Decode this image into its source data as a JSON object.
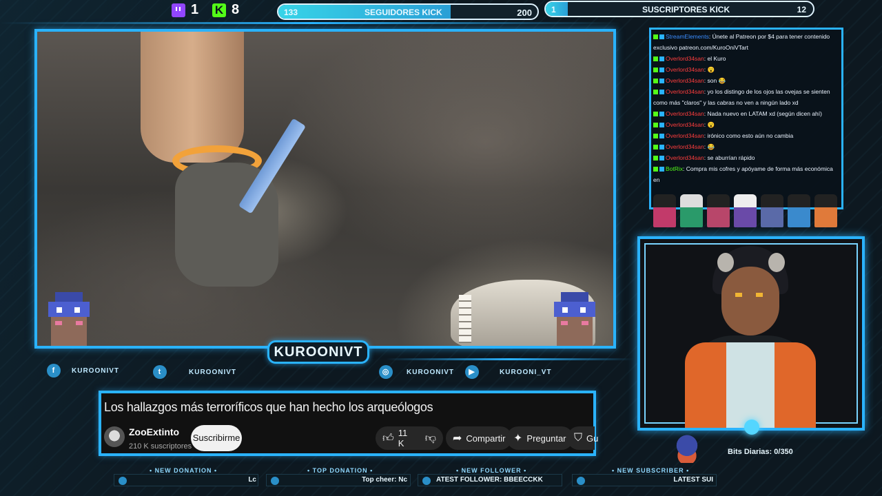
{
  "top_bar": {
    "twitch_count": "1",
    "kick_count": "8",
    "followers_goal": {
      "current": "133",
      "label": "SEGUIDORES KICK",
      "target": "200",
      "progress": 0.665
    },
    "subs_goal": {
      "current": "1",
      "label": "SUSCRIPTORES KICK",
      "target": "12",
      "progress": 0.083
    }
  },
  "streamer_name": "KUROONIVT",
  "socials": [
    {
      "icon": "facebook-icon",
      "glyph": "f",
      "handle": "KUROONIVT"
    },
    {
      "icon": "twitter-icon",
      "glyph": "t",
      "handle": "KUROONIVT"
    },
    {
      "icon": "instagram-icon",
      "glyph": "◎",
      "handle": "KUROONIVT"
    },
    {
      "icon": "youtube-icon",
      "glyph": "▶",
      "handle": "KUROONI_VT"
    }
  ],
  "video": {
    "title": "Los hallazgos más terroríficos que han hecho los arqueólogos",
    "channel": "ZooExtinto",
    "subscribers": "210 K suscriptores",
    "subscribe_label": "Suscribirme",
    "likes": "11 K",
    "share_label": "Compartir",
    "ask_label": "Preguntar",
    "save_label": "Gu"
  },
  "alerts": [
    {
      "label": "• NEW DONATION •",
      "value": "Lc"
    },
    {
      "label": "• TOP DONATION •",
      "value": "Top cheer: Nc"
    },
    {
      "label": "• NEW FOLLOWER •",
      "value": "ATEST FOLLOWER: BBEECCKK"
    },
    {
      "label": "• NEW SUBSCRIBER •",
      "value": "LATEST SUI"
    }
  ],
  "chat": [
    {
      "user": "StreamElements",
      "type": "se",
      "message": ": Únete al Patreon por $4 para tener contenido exclusivo patreon.com/KuroOniVTart"
    },
    {
      "user": "Overlord34san",
      "type": "user",
      "message": ": el Kuro"
    },
    {
      "user": "Overlord34san",
      "type": "user",
      "message": ": 😮"
    },
    {
      "user": "Overlord34san",
      "type": "user",
      "message": ": son 😂"
    },
    {
      "user": "Overlord34san",
      "type": "user",
      "message": ": yo los distingo de los ojos las ovejas se sienten como más \"claros\" y las cabras no ven a ningún lado xd"
    },
    {
      "user": "Overlord34san",
      "type": "user",
      "message": ": Nada nuevo en LATAM xd (según dicen ahí)"
    },
    {
      "user": "Overlord34san",
      "type": "user",
      "message": ": 😮"
    },
    {
      "user": "Overlord34san",
      "type": "user",
      "message": ": irónico como esto aún no cambia"
    },
    {
      "user": "Overlord34san",
      "type": "user",
      "message": ": 😂"
    },
    {
      "user": "Overlord34san",
      "type": "user",
      "message": ": se aburrían rápido"
    },
    {
      "user": "BotRix",
      "type": "bot",
      "message": ": Compra mis cofres y apóyame de forma más económica en"
    }
  ],
  "bits": {
    "label": "Bits Diarias:",
    "value": "0/350"
  },
  "colors": {
    "accent": "#2ab3ff",
    "kick": "#53fc18",
    "twitch": "#9146ff"
  }
}
